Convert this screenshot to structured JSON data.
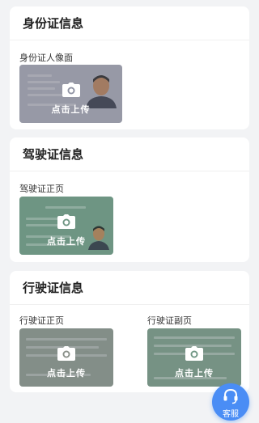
{
  "sections": {
    "id_card": {
      "title": "身份证信息",
      "portrait": {
        "label": "身份证人像面",
        "cta": "点击上传"
      }
    },
    "driver_license": {
      "title": "驾驶证信息",
      "front": {
        "label": "驾驶证正页",
        "cta": "点击上传"
      }
    },
    "vehicle_license": {
      "title": "行驶证信息",
      "front": {
        "label": "行驶证正页",
        "cta": "点击上传"
      },
      "back": {
        "label": "行驶证副页",
        "cta": "点击上传"
      }
    }
  },
  "customer_service": {
    "label": "客服"
  },
  "icons": {
    "upload": "camera-icon",
    "service": "headset-icon"
  },
  "colors": {
    "accent": "#4a8df5",
    "background": "#f2f3f5"
  }
}
